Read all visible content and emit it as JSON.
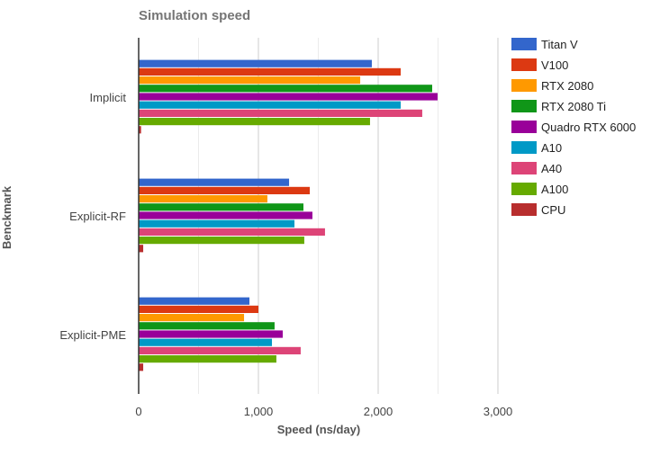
{
  "chart_data": {
    "type": "bar",
    "orientation": "horizontal",
    "title": "Simulation speed",
    "xlabel": "Speed (ns/day)",
    "ylabel": "Benckmark",
    "xlim": [
      0,
      3000
    ],
    "x_ticks": [
      0,
      1000,
      2000,
      3000
    ],
    "x_tick_labels": [
      "0",
      "1,000",
      "2,000",
      "3,000"
    ],
    "minor_gridlines": [
      500,
      1500,
      2500
    ],
    "grid": true,
    "legend_position": "right",
    "categories": [
      "Implicit",
      "Explicit-RF",
      "Explicit-PME"
    ],
    "series": [
      {
        "name": "Titan V",
        "color": "#3366cc",
        "values": [
          1947,
          1256,
          925
        ]
      },
      {
        "name": "V100",
        "color": "#dc3912",
        "values": [
          2188,
          1429,
          1000
        ]
      },
      {
        "name": "RTX 2080",
        "color": "#ff9900",
        "values": [
          1850,
          1075,
          880
        ]
      },
      {
        "name": "RTX 2080 Ti",
        "color": "#109618",
        "values": [
          2451,
          1376,
          1135
        ]
      },
      {
        "name": "Quadro RTX 6000",
        "color": "#990099",
        "values": [
          2496,
          1451,
          1203
        ]
      },
      {
        "name": "A10",
        "color": "#0099c6",
        "values": [
          2188,
          1301,
          1113
        ]
      },
      {
        "name": "A40",
        "color": "#dd4477",
        "values": [
          2368,
          1556,
          1353
        ]
      },
      {
        "name": "A100",
        "color": "#66aa00",
        "values": [
          1932,
          1383,
          1150
        ]
      },
      {
        "name": "CPU",
        "color": "#b82e2e",
        "values": [
          20,
          38,
          38
        ]
      }
    ]
  }
}
